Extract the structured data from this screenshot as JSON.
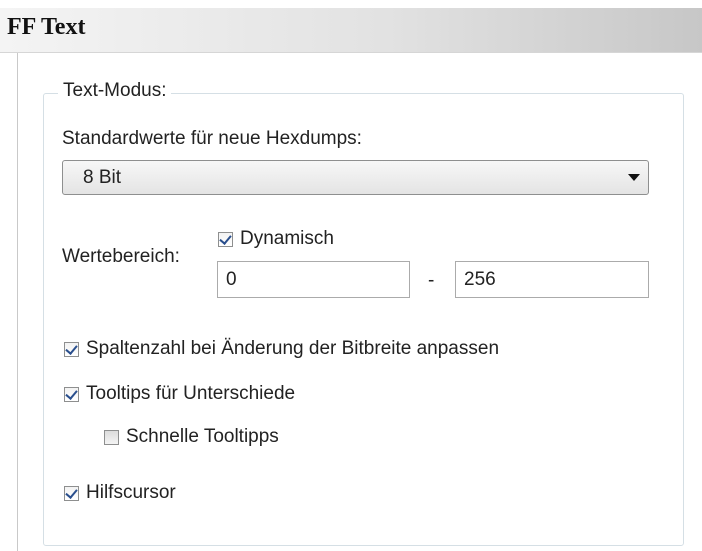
{
  "window": {
    "title": "FF Text"
  },
  "group": {
    "legend": "Text-Modus:"
  },
  "defaults": {
    "label": "Standardwerte für neue Hexdumps:",
    "selected": "8 Bit"
  },
  "range": {
    "label": "Wertebereich:",
    "dynamic_label": "Dynamisch",
    "dynamic_checked": true,
    "min": "0",
    "separator": "-",
    "max": "256"
  },
  "options": [
    {
      "label": "Spaltenzahl bei Änderung der Bitbreite anpassen",
      "checked": true
    },
    {
      "label": "Tooltips für Unterschiede",
      "checked": true
    },
    {
      "label": "Schnelle Tooltipps",
      "checked": false
    },
    {
      "label": "Hilfscursor",
      "checked": true
    }
  ]
}
